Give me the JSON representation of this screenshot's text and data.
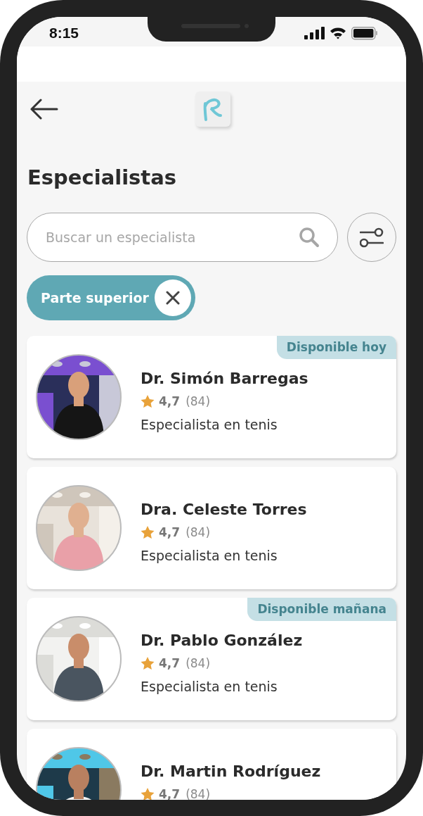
{
  "status_bar": {
    "time": "8:15"
  },
  "header": {
    "title": "Especialistas"
  },
  "search": {
    "placeholder": "Buscar un especialista"
  },
  "filter_chips": [
    {
      "label": "Parte superior"
    }
  ],
  "specialists": [
    {
      "name": "Dr. Simón Barregas",
      "rating": "4,7",
      "reviews": "(84)",
      "specialty": "Especialista en tenis",
      "badge": "Disponible hoy"
    },
    {
      "name": "Dra. Celeste Torres",
      "rating": "4,7",
      "reviews": "(84)",
      "specialty": "Especialista en tenis"
    },
    {
      "name": "Dr. Pablo González",
      "rating": "4,7",
      "reviews": "(84)",
      "specialty": "Especialista en tenis",
      "badge": "Disponible mañana"
    },
    {
      "name": "Dr. Martin Rodríguez",
      "rating": "4,7",
      "reviews": "(84)"
    }
  ]
}
